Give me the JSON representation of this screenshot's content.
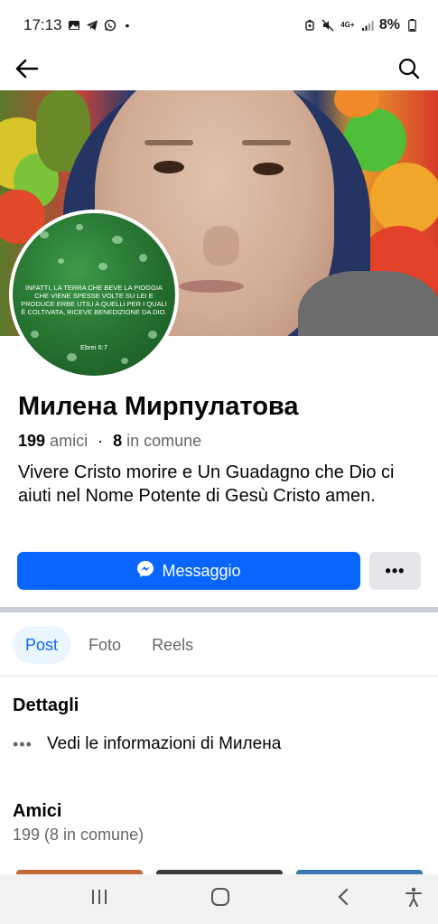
{
  "status_bar": {
    "time": "17:13",
    "left_icons": [
      "gallery-icon",
      "telegram-icon",
      "whatsapp-icon"
    ],
    "dot": "•",
    "network": "4G+",
    "battery": "8%"
  },
  "nav": {
    "back_icon": "arrow-left-icon",
    "search_icon": "search-icon"
  },
  "avatar": {
    "quote": "INFATTI, LA TERRA CHE BEVE LA PIOGGIA CHE VIENE SPESSE VOLTE SU LEI E PRODUCE ERBE UTILI A QUELLI PER I QUALI È COLTIVATA, RICEVE BENEDIZIONE DA DIO.",
    "reference": "Ebrei 6:7"
  },
  "profile": {
    "name": "Милена Мирпулатова",
    "friends_count": "199",
    "friends_label": "amici",
    "separator": "·",
    "mutual_count": "8",
    "mutual_label": "in comune",
    "bio": "Vivere Cristo morire e Un Guadagno che Dio ci aiuti nel Nome Potente di Gesù Cristo amen."
  },
  "actions": {
    "message_label": "Messaggio",
    "more_label": "•••"
  },
  "tabs": [
    {
      "label": "Post",
      "active": true
    },
    {
      "label": "Foto",
      "active": false
    },
    {
      "label": "Reels",
      "active": false
    }
  ],
  "details": {
    "title": "Dettagli",
    "info_label": "Vedi le informazioni di Милена",
    "dots": "•••"
  },
  "friends": {
    "title": "Amici",
    "subtitle": "199 (8 in comune)"
  },
  "colors": {
    "accent": "#0866ff",
    "tab_active_bg": "#ebf5ff",
    "secondary_button": "#e4e6eb",
    "muted_text": "#65676b"
  }
}
